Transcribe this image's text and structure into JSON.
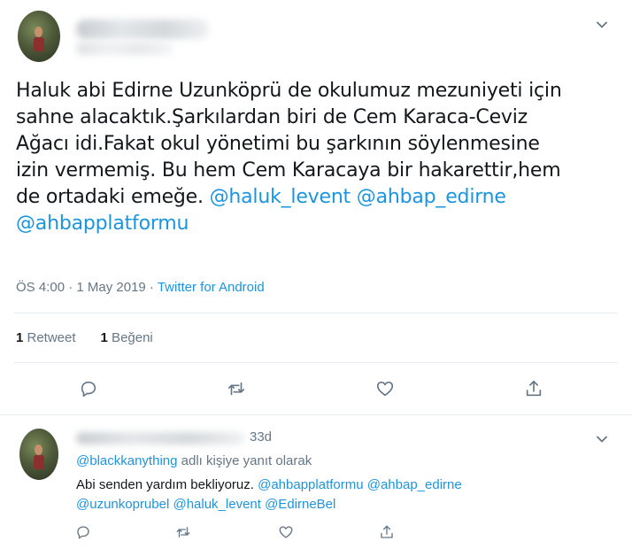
{
  "tweet": {
    "text_lines": [
      "Haluk abi Edirne Uzunköprü de okulumuz mezuniyeti için",
      "sahne alacaktık.Şarkılardan biri de Cem Karaca-Ceviz",
      "Ağacı idi.Fakat okul yönetimi bu şarkının söylenmesine",
      "izin vermemiş. Bu hem Cem Karacaya bir hakarettir,hem",
      "de ortadaki emeğe. "
    ],
    "mentions_line5": "@haluk_levent @ahbap_edirne",
    "mentions_line6": "@ahbapplatformu",
    "time": "ÖS 4:00 · 1 May 2019 · ",
    "source": "Twitter for Android",
    "retweet_count": "1",
    "retweet_label": " Retweet",
    "like_count": "1",
    "like_label": " Beğeni"
  },
  "reply": {
    "age": "33d",
    "reply_to_handle": "@blackkanything",
    "reply_to_suffix": " adlı kişiye yanıt olarak",
    "text_plain": "Abi senden yardım bekliyoruz. ",
    "mentions_a": "@ahbapplatformu @ahbap_edirne",
    "mentions_b": "@uzunkoprubel @haluk_levent @EdirneBel"
  },
  "icons": {
    "reply": "reply-icon",
    "retweet": "retweet-icon",
    "like": "heart-icon",
    "share": "share-icon",
    "menu": "chevron-down-icon"
  },
  "colors": {
    "link": "#1b95e0",
    "muted": "#657786",
    "text": "#14171a",
    "divider": "#e6ecf0"
  }
}
